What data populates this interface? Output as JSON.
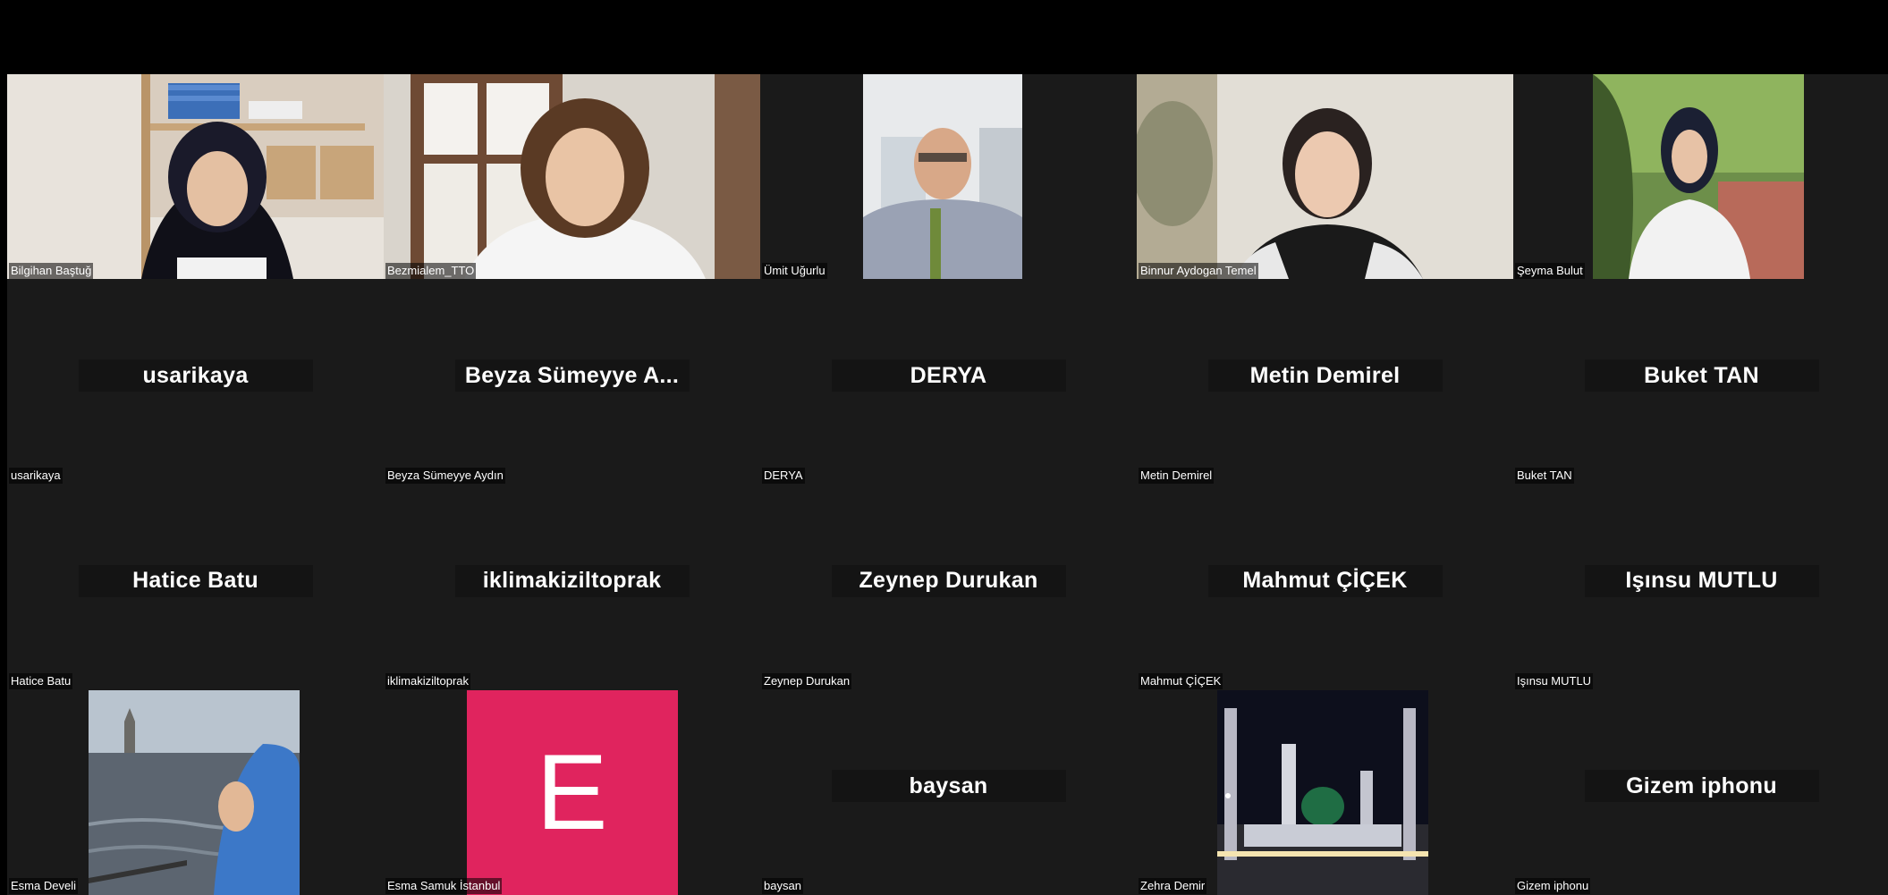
{
  "participants": [
    {
      "label": "Bilgihan Baştuğ",
      "display": "",
      "kind": "video"
    },
    {
      "label": "Bezmialem_TTO",
      "display": "",
      "kind": "video"
    },
    {
      "label": "Ümit Uğurlu",
      "display": "",
      "kind": "video"
    },
    {
      "label": "Binnur Aydogan Temel",
      "display": "",
      "kind": "video"
    },
    {
      "label": "Şeyma Bulut",
      "display": "",
      "kind": "video"
    },
    {
      "label": "usarikaya",
      "display": "usarikaya",
      "kind": "name"
    },
    {
      "label": "Beyza Sümeyye Aydın",
      "display": "Beyza Sümeyye A...",
      "kind": "name"
    },
    {
      "label": "DERYA",
      "display": "DERYA",
      "kind": "name"
    },
    {
      "label": "Metin Demirel",
      "display": "Metin Demirel",
      "kind": "name"
    },
    {
      "label": "Buket TAN",
      "display": "Buket TAN",
      "kind": "name"
    },
    {
      "label": "Hatice Batu",
      "display": "Hatice Batu",
      "kind": "name"
    },
    {
      "label": "iklimakiziltoprak",
      "display": "iklimakiziltoprak",
      "kind": "name"
    },
    {
      "label": "Zeynep Durukan",
      "display": "Zeynep Durukan",
      "kind": "name"
    },
    {
      "label": "Mahmut ÇİÇEK",
      "display": "Mahmut ÇİÇEK",
      "kind": "name"
    },
    {
      "label": "Işınsu MUTLU",
      "display": "Işınsu MUTLU",
      "kind": "name"
    },
    {
      "label": "Esma Develi",
      "display": "",
      "kind": "video"
    },
    {
      "label": "Esma Samuk İstanbul",
      "display": "E",
      "kind": "avatar"
    },
    {
      "label": "baysan",
      "display": "baysan",
      "kind": "name"
    },
    {
      "label": "Zehra Demir",
      "display": "",
      "kind": "video"
    },
    {
      "label": "Gizem iphonu",
      "display": "Gizem iphonu",
      "kind": "name"
    }
  ],
  "colors": {
    "background": "#000000",
    "tile_background": "#1a1a1a",
    "avatar_pink": "#e0245e"
  }
}
